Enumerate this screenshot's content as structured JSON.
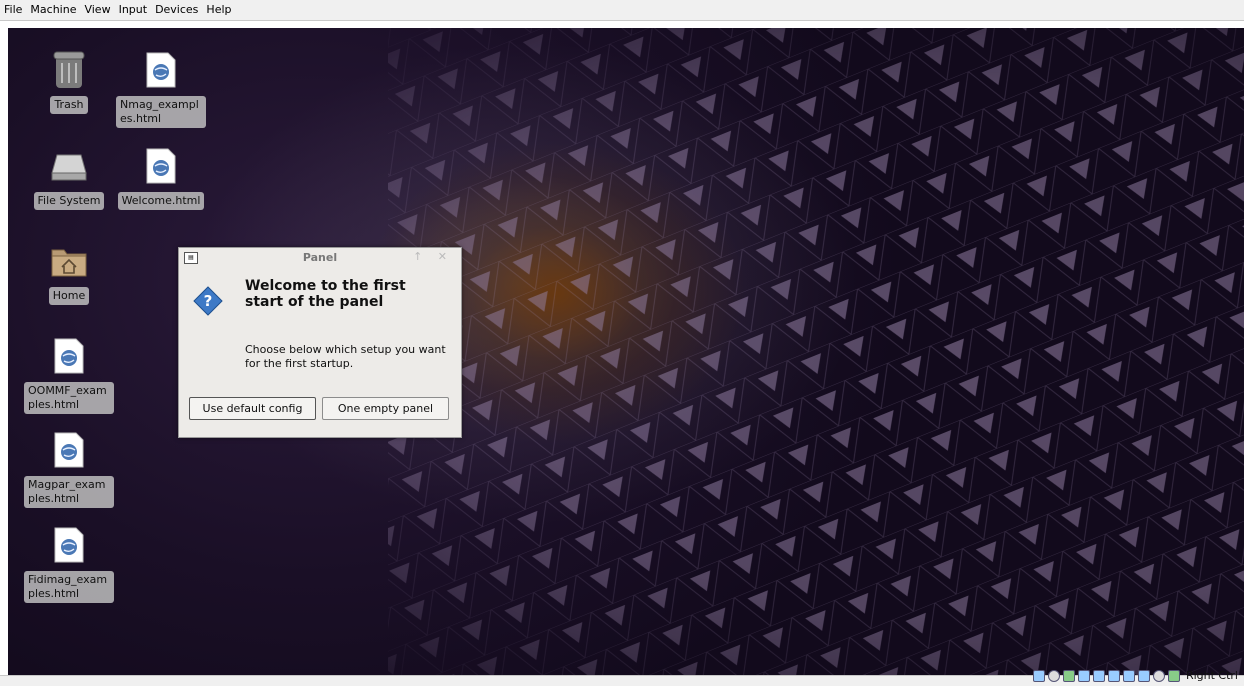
{
  "host_menu": [
    "File",
    "Machine",
    "View",
    "Input",
    "Devices",
    "Help"
  ],
  "desktop_icons": {
    "trash": "Trash",
    "nmag": "Nmag_examples.html",
    "filesystem": "File System",
    "welcome": "Welcome.html",
    "home": "Home",
    "oommf": "OOMMF_examples.html",
    "magpar": "Magpar_examples.html",
    "fidimag": "Fidimag_examples.html"
  },
  "dialog": {
    "title": "Panel",
    "heading": "Welcome to the first start of the panel",
    "body": "Choose below which setup you want for the first startup.",
    "default_button": "Use default config",
    "empty_button": "One empty panel",
    "titlebar_buttons": "↑ ✕"
  },
  "statusbar": {
    "host_key": "Right Ctrl",
    "tray_icons": [
      "storage-icon",
      "optical-drive-icon",
      "network-icon",
      "usb-icon",
      "shared-folder-icon",
      "display-icon",
      "recording-icon",
      "capture-icon",
      "mouse-integration-icon",
      "keyboard-icon"
    ]
  }
}
